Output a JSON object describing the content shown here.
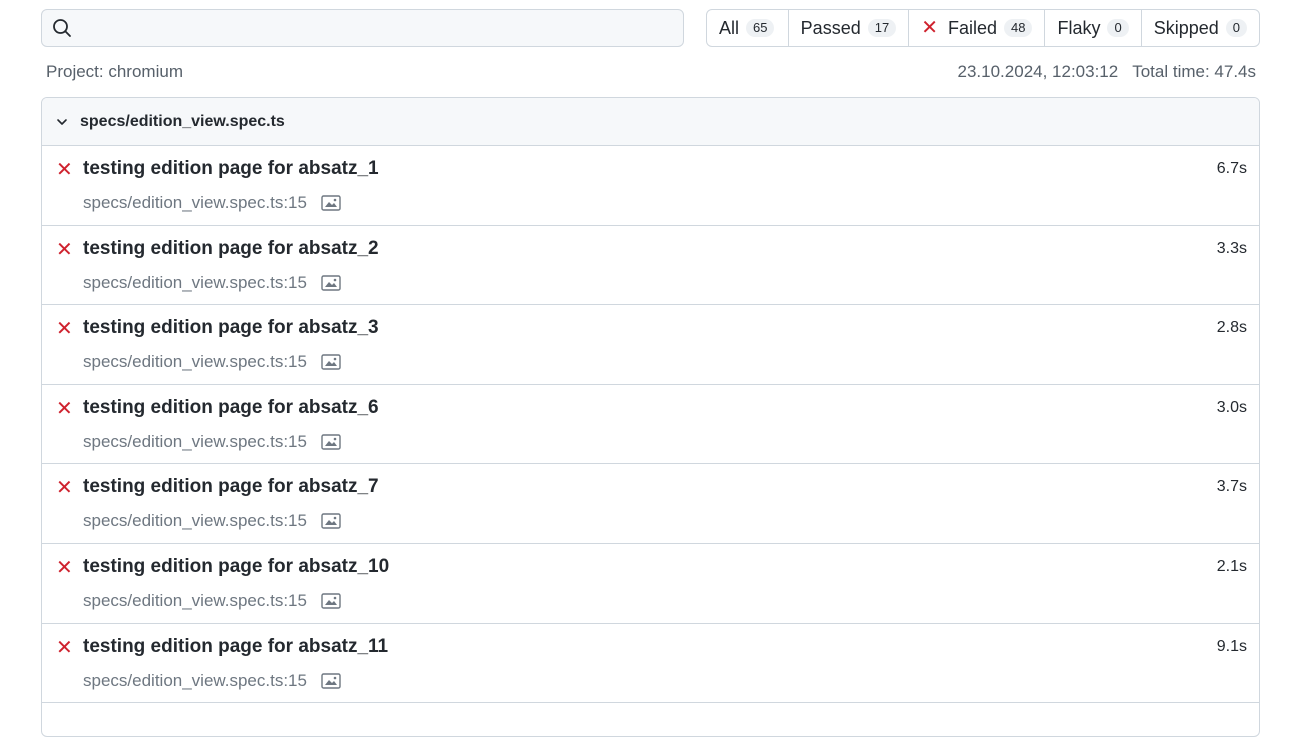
{
  "search": {
    "value": "",
    "placeholder": ""
  },
  "filters": [
    {
      "label": "All",
      "count": "65"
    },
    {
      "label": "Passed",
      "count": "17"
    },
    {
      "label": "Failed",
      "count": "48"
    },
    {
      "label": "Flaky",
      "count": "0"
    },
    {
      "label": "Skipped",
      "count": "0"
    }
  ],
  "meta": {
    "project": "Project: chromium",
    "timestamp": "23.10.2024, 12:03:12",
    "total_time": "Total time: 47.4s"
  },
  "group": {
    "title": "specs/edition_view.spec.ts",
    "tests": [
      {
        "name": "testing edition page for absatz_1",
        "location": "specs/edition_view.spec.ts:15",
        "duration": "6.7s"
      },
      {
        "name": "testing edition page for absatz_2",
        "location": "specs/edition_view.spec.ts:15",
        "duration": "3.3s"
      },
      {
        "name": "testing edition page for absatz_3",
        "location": "specs/edition_view.spec.ts:15",
        "duration": "2.8s"
      },
      {
        "name": "testing edition page for absatz_6",
        "location": "specs/edition_view.spec.ts:15",
        "duration": "3.0s"
      },
      {
        "name": "testing edition page for absatz_7",
        "location": "specs/edition_view.spec.ts:15",
        "duration": "3.7s"
      },
      {
        "name": "testing edition page for absatz_10",
        "location": "specs/edition_view.spec.ts:15",
        "duration": "2.1s"
      },
      {
        "name": "testing edition page for absatz_11",
        "location": "specs/edition_view.spec.ts:15",
        "duration": "9.1s"
      }
    ]
  },
  "icons": {
    "search": "search-icon",
    "failed": "cross-icon",
    "chevron": "chevron-down-icon",
    "image": "image-icon"
  },
  "colors": {
    "failed": "#cf222e",
    "border": "#d0d7de",
    "muted": "#57606a"
  }
}
